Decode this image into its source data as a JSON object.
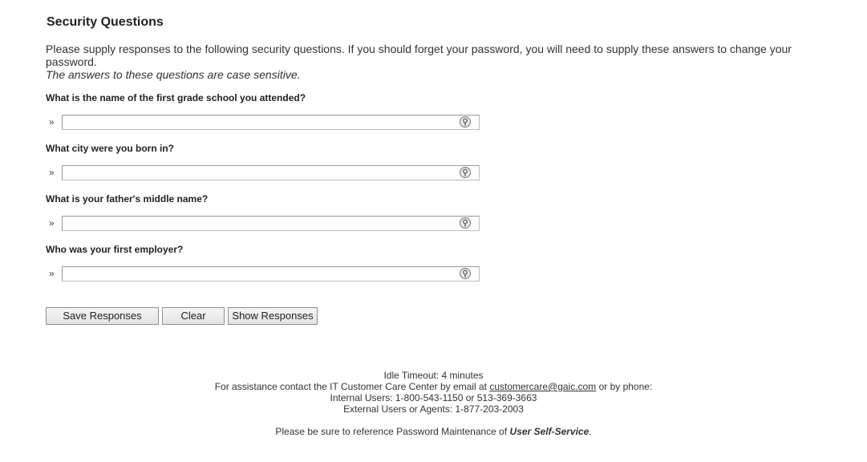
{
  "page": {
    "title": "Security Questions",
    "intro": "Please supply responses to the following security questions.  If you should forget your password, you will need to supply these answers to change your password.",
    "intro_note": "The answers to these questions are case sensitive."
  },
  "questions": [
    {
      "label": "What is the name of the first grade school you attended?",
      "value": ""
    },
    {
      "label": "What city were you born in?",
      "value": ""
    },
    {
      "label": "What is your father's middle name?",
      "value": ""
    },
    {
      "label": "Who was your first employer?",
      "value": ""
    }
  ],
  "field_marker": "»",
  "buttons": {
    "save": "Save Responses",
    "clear": "Clear",
    "show": "Show Responses"
  },
  "footer": {
    "idle": "Idle Timeout: 4 minutes",
    "assist_prefix": "For assistance contact the IT Customer Care Center by email at",
    "email": "customercare@gaic.com",
    "assist_suffix": "or by phone:",
    "internal": "Internal Users: 1-800-543-1150 or 513-369-3663",
    "external": "External Users or Agents: 1-877-203-2003",
    "ref_prefix": "Please be sure to reference Password Maintenance of",
    "ref_app": "User Self-Service",
    "ref_suffix": "."
  },
  "icons": {
    "field_icon": "key-icon"
  }
}
